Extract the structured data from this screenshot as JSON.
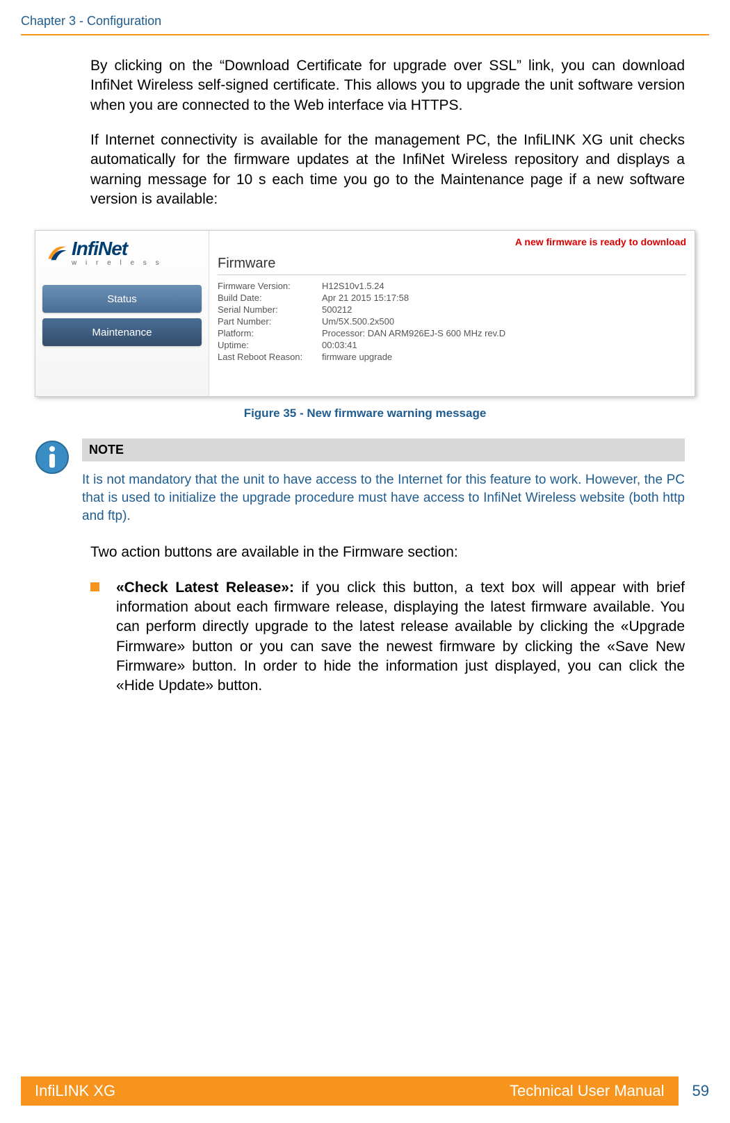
{
  "header": "Chapter 3 - Configuration",
  "para1": "By clicking on the “Download Certificate for upgrade over SSL” link, you can download InfiNet Wireless self-signed certificate. This allows you to upgrade the unit software version when you are connected to the Web interface via HTTPS.",
  "para2": "If Internet connectivity is available for the management PC, the InfiLINK XG unit checks automatically for the firmware updates at the InfiNet Wireless repository and displays a warning message for 10 s each time you go to the Maintenance page if a new software version is available:",
  "screenshot": {
    "logo_main": "InfiNet",
    "logo_sub": "w i r e l e s s",
    "nav": {
      "status": "Status",
      "maintenance": "Maintenance"
    },
    "warning": "A new firmware is ready to download",
    "section": "Firmware",
    "rows": [
      {
        "label": "Firmware Version:",
        "value": "H12S10v1.5.24"
      },
      {
        "label": "Build Date:",
        "value": "Apr 21 2015 15:17:58"
      },
      {
        "label": "Serial Number:",
        "value": "500212"
      },
      {
        "label": "Part Number:",
        "value": "Um/5X.500.2x500"
      },
      {
        "label": "Platform:",
        "value": "Processor: DAN ARM926EJ-S 600 MHz rev.D"
      },
      {
        "label": "Uptime:",
        "value": "00:03:41"
      },
      {
        "label": "Last Reboot Reason:",
        "value": "firmware upgrade"
      }
    ]
  },
  "figure_caption": "Figure 35 - New firmware warning message",
  "note": {
    "title": "NOTE",
    "text": "It is not mandatory that the unit to have access to the Internet for this feature to work. However, the PC that is used to initialize the upgrade procedure must have access to InfiNet Wireless website (both http and ftp)."
  },
  "para3": "Two action buttons are available in the Firmware section:",
  "bullet": {
    "lead": "«Check Latest Release»: ",
    "rest": "if you click this button, a text box will appear with brief information about each firmware release, displaying the latest firmware available. You can perform directly upgrade to the latest release available by clicking the «Upgrade Firmware» button or you can save the newest firmware by clicking the «Save New Firmware» button. In order to hide the information just displayed, you can click the «Hide Update» button."
  },
  "footer": {
    "left": "InfiLINK XG",
    "right": "Technical User Manual",
    "page": "59"
  }
}
